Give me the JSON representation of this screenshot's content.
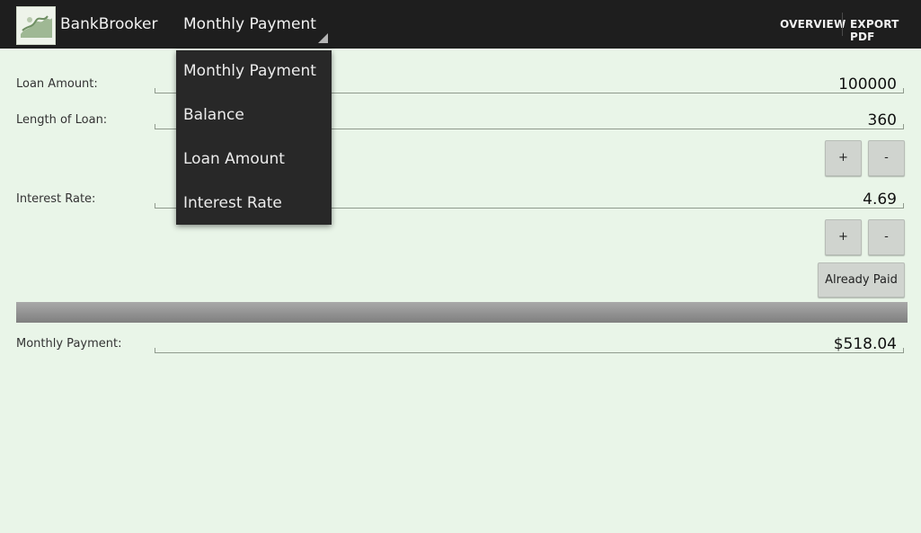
{
  "actionbar": {
    "app_title": "BankBrooker",
    "nav_selected": "Monthly Payment",
    "actions": [
      "OVERVIEW",
      "EXPORT PDF"
    ]
  },
  "form": {
    "loan_amount": {
      "label": "Loan Amount:",
      "value": "100000"
    },
    "length_of_loan": {
      "label": "Length of Loan:",
      "value": "360"
    },
    "interest_rate": {
      "label": "Interest Rate:",
      "value": "4.69"
    },
    "plus_label": "+",
    "minus_label": "-",
    "already_paid_label": "Already Paid",
    "monthly_payment": {
      "label": "Monthly Payment:",
      "value": "$518.04"
    }
  },
  "dropdown": {
    "items": [
      "Monthly Payment",
      "Balance",
      "Loan Amount",
      "Interest Rate"
    ]
  },
  "colors": {
    "actionbar_bg": "#1e1e1e",
    "content_bg": "#e9f5e8",
    "dropdown_bg": "#282828"
  }
}
